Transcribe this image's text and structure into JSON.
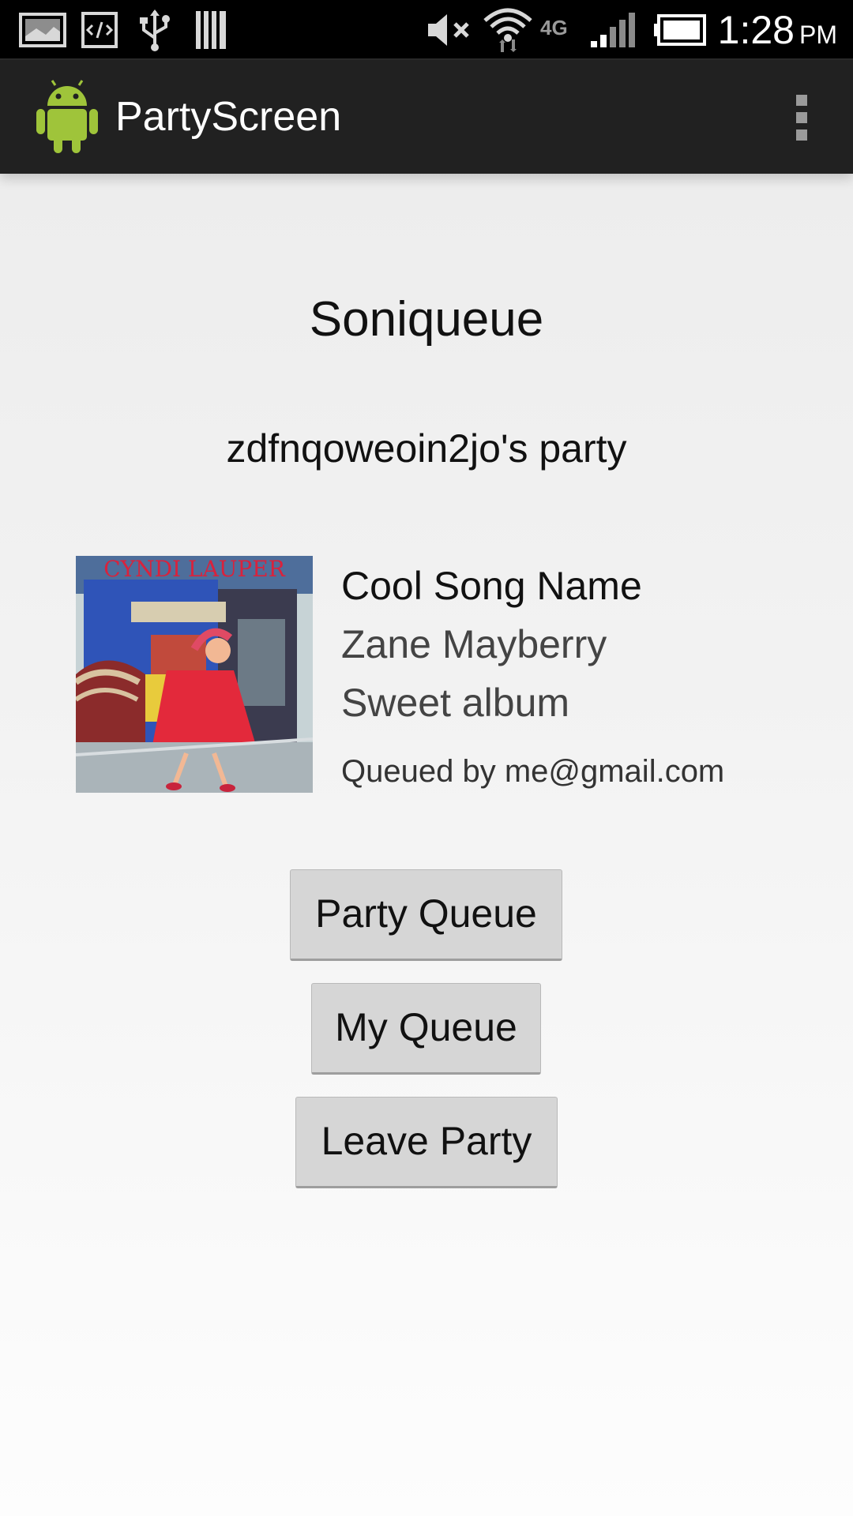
{
  "status_bar": {
    "time": "1:28",
    "ampm": "PM",
    "network_label": "4G",
    "icons": [
      "gallery-icon",
      "developer-code-icon",
      "usb-icon",
      "barcode-icon",
      "mute-icon",
      "wifi-icon",
      "network-4g-icon",
      "signal-icon",
      "battery-icon"
    ]
  },
  "action_bar": {
    "title": "PartyScreen",
    "logo_icon": "android-robot-icon",
    "menu_icon": "overflow-menu-icon"
  },
  "content": {
    "app_name": "Soniqueue",
    "party_name": "zdfnqoweoin2jo's party",
    "now_playing": {
      "album_art_caption": "CYNDI LAUPER",
      "song_title": "Cool Song Name",
      "artist": "Zane Mayberry",
      "album": "Sweet album",
      "queued_by": "Queued by me@gmail.com"
    }
  },
  "buttons": {
    "party_queue": "Party Queue",
    "my_queue": "My Queue",
    "leave_party": "Leave Party"
  },
  "colors": {
    "status_bar_bg": "#000000",
    "action_bar_bg": "#212121",
    "android_green": "#9fc43a",
    "button_bg": "#d6d6d6"
  }
}
